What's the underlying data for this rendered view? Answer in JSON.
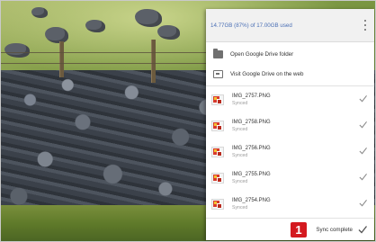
{
  "drive_popup": {
    "storage_usage": "14.77GB (87%) of 17.00GB used",
    "more_menu_icon": "vertical-ellipsis-icon",
    "menu": [
      {
        "label": "Open Google Drive folder",
        "icon": "folder-icon"
      },
      {
        "label": "Visit Google Drive on the web",
        "icon": "drive-icon"
      }
    ],
    "files": [
      {
        "name": "IMG_2757.PNG",
        "status": "Synced"
      },
      {
        "name": "IMG_2758.PNG",
        "status": "Synced"
      },
      {
        "name": "IMG_2756.PNG",
        "status": "Synced"
      },
      {
        "name": "IMG_2755.PNG",
        "status": "Synced"
      },
      {
        "name": "IMG_2754.PNG",
        "status": "Synced"
      }
    ],
    "footer_status": "Sync complete"
  },
  "callout": {
    "number": "1",
    "color": "#d4191f"
  },
  "colors": {
    "usage_text": "#4a6fb5",
    "check": "#7a7a7a"
  }
}
